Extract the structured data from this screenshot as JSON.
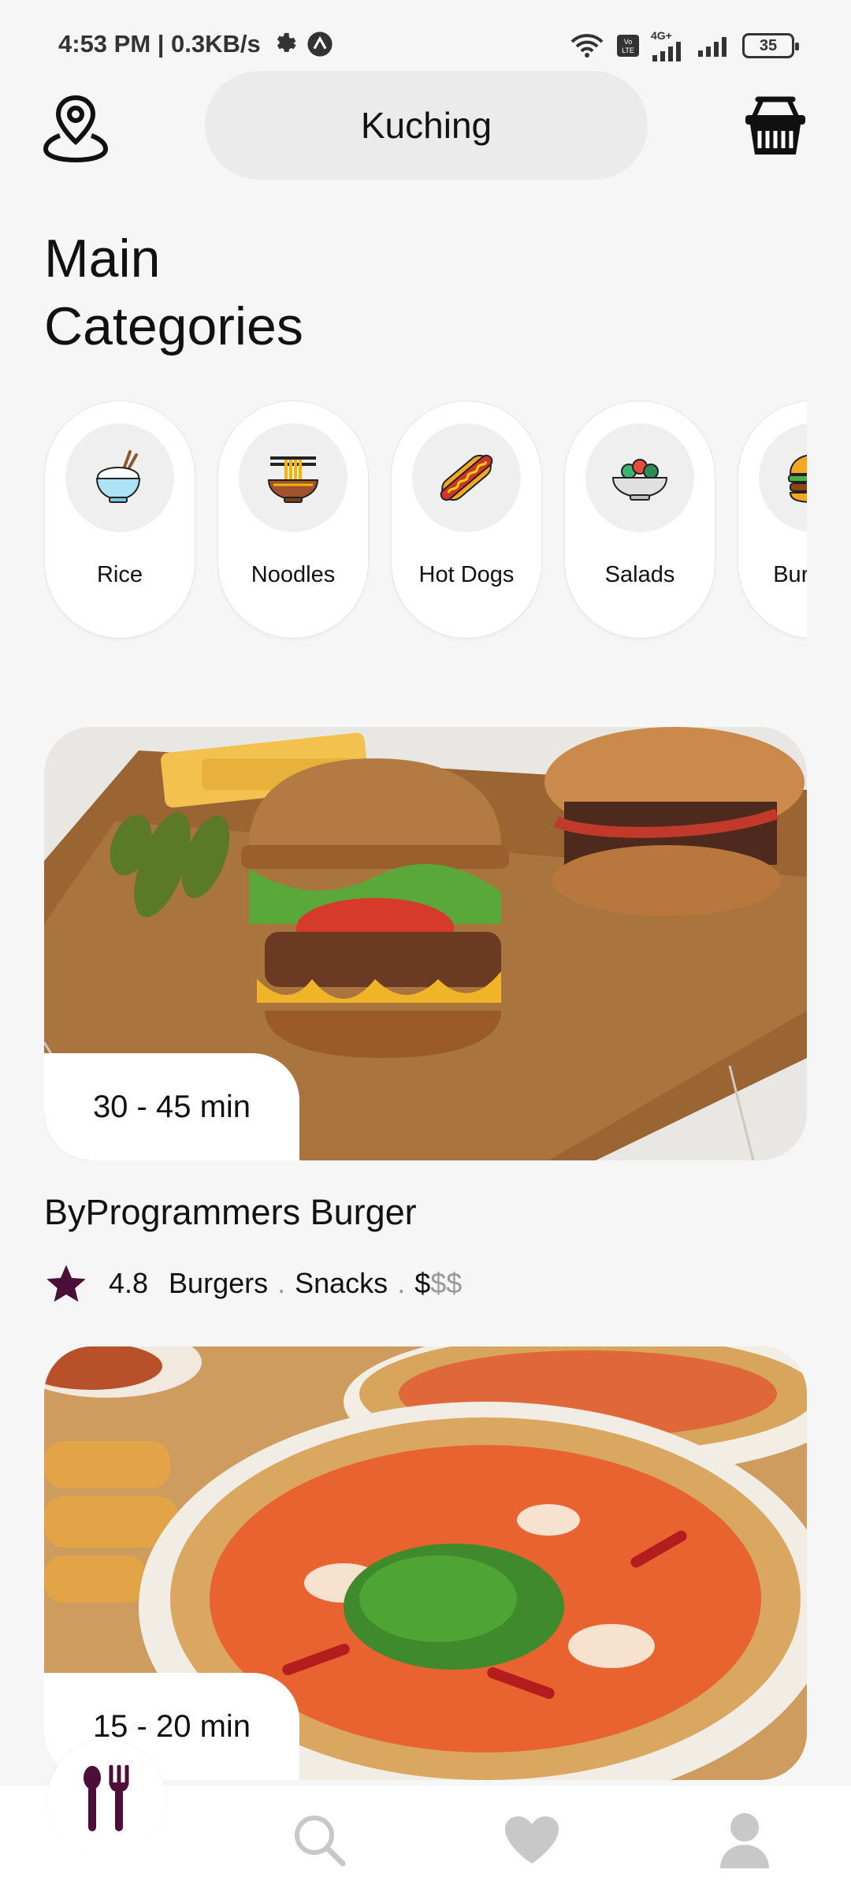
{
  "status_bar": {
    "time_speed": "4:53 PM | 0.3KB/s",
    "network": "4G+",
    "battery": "35"
  },
  "header": {
    "location": "Kuching"
  },
  "page_title": {
    "line1": "Main",
    "line2": "Categories"
  },
  "categories": [
    {
      "label": "Rice",
      "icon": "rice-bowl-icon"
    },
    {
      "label": "Noodles",
      "icon": "noodles-icon"
    },
    {
      "label": "Hot Dogs",
      "icon": "hot-dog-icon"
    },
    {
      "label": "Salads",
      "icon": "salad-icon"
    },
    {
      "label": "Burgers",
      "icon": "burger-icon"
    }
  ],
  "restaurants": [
    {
      "name": "ByProgrammers Burger",
      "delivery_time": "30 - 45 min",
      "rating": "4.8",
      "tags": [
        "Burgers",
        "Snacks"
      ],
      "price_active": "$",
      "price_inactive": "$$"
    },
    {
      "name": "",
      "delivery_time": "15 - 20 min"
    }
  ],
  "colors": {
    "accent": "#4b0f3a",
    "muted_icon": "#c8c8c8"
  }
}
